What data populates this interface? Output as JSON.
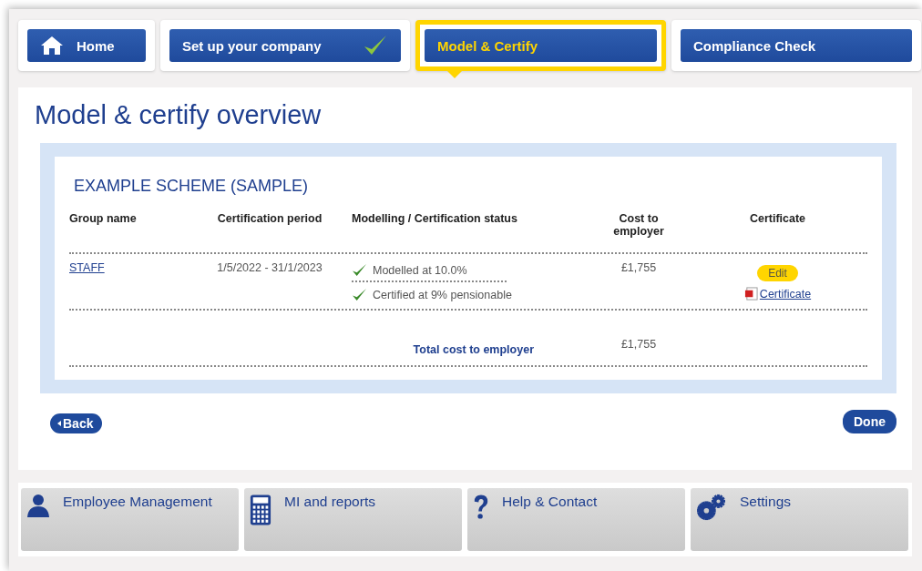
{
  "tabs": [
    {
      "label": "Home",
      "kind": "home",
      "selected": false,
      "done": false
    },
    {
      "label": "Set up your company",
      "kind": "step",
      "selected": false,
      "done": true
    },
    {
      "label": "Model & Certify",
      "kind": "step",
      "selected": true,
      "done": false
    },
    {
      "label": "Compliance Check",
      "kind": "step",
      "selected": false,
      "done": false
    }
  ],
  "title": "Model & certify overview",
  "scheme": {
    "title": "EXAMPLE SCHEME (SAMPLE)",
    "columns": [
      "Group name",
      "Certification period",
      "Modelling / Certification status",
      "Cost to employer",
      "Certificate"
    ],
    "rows": [
      {
        "group": "STAFF",
        "period": "1/5/2022 - 31/1/2023",
        "statuses": [
          "Modelled at 10.0%",
          "Certified at 9% pensionable"
        ],
        "cost": "£1,755",
        "edit": "Edit",
        "certificate": "Certificate"
      }
    ],
    "total_label": "Total cost to employer",
    "total": "£1,755"
  },
  "back": "Back",
  "done": "Done",
  "nav": [
    {
      "label": "Employee Management",
      "kind": "person"
    },
    {
      "label": "MI and reports",
      "kind": "calculator"
    },
    {
      "label": "Help & Contact",
      "kind": "help"
    },
    {
      "label": "Settings",
      "kind": "gears"
    }
  ]
}
